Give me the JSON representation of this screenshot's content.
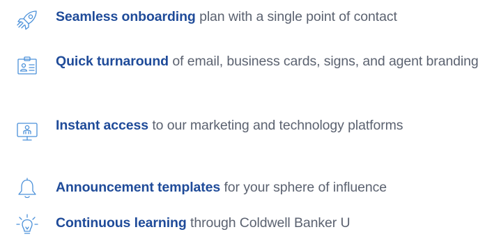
{
  "features": [
    {
      "icon": "rocket-icon",
      "highlight": "Seamless onboarding",
      "rest": " plan with a single point of contact"
    },
    {
      "icon": "id-card-icon",
      "highlight": "Quick turnaround",
      "rest": " of email, business cards, signs, and agent branding"
    },
    {
      "icon": "monitor-user-icon",
      "highlight": "Instant access",
      "rest": " to our marketing and technology platforms"
    },
    {
      "icon": "bell-icon",
      "highlight": "Announcement templates",
      "rest": " for your sphere of influence"
    },
    {
      "icon": "lightbulb-icon",
      "highlight": "Continuous learning",
      "rest": " through Coldwell Banker U"
    }
  ],
  "colors": {
    "accent": "#1f4b99",
    "icon": "#4a90d9",
    "body_text": "#5b6270"
  }
}
